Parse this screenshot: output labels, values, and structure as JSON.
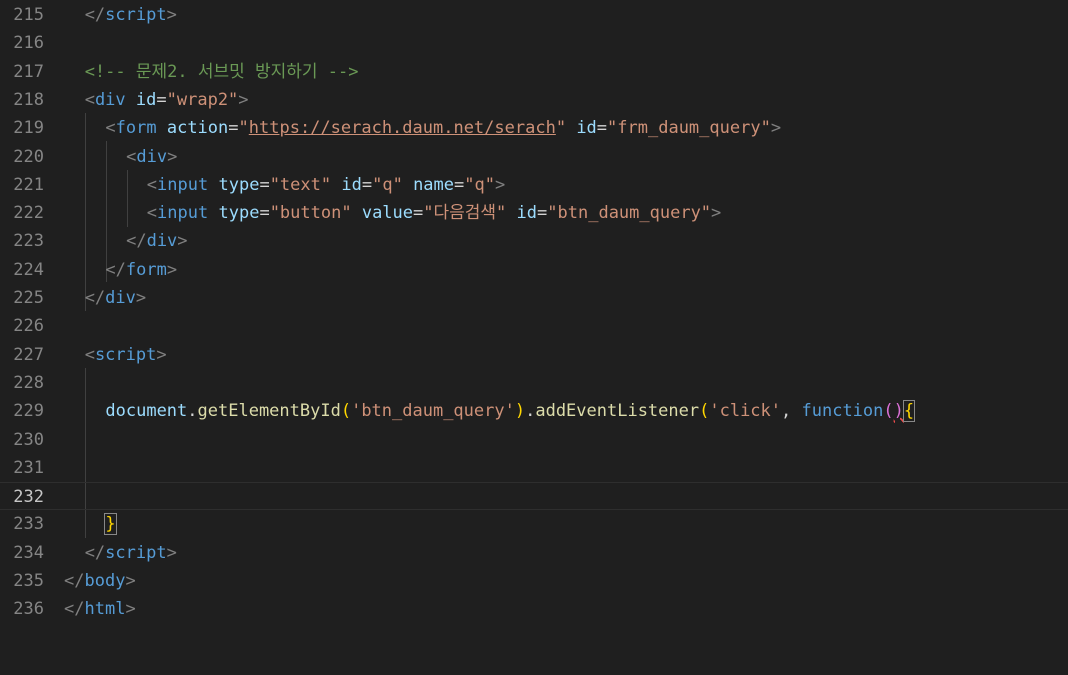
{
  "editor": {
    "lines": [
      {
        "no": "215",
        "indent": 1,
        "tokens": [
          [
            "t-punc",
            "</"
          ],
          [
            "t-tag",
            "script"
          ],
          [
            "t-punc",
            ">"
          ]
        ]
      },
      {
        "no": "216",
        "indent": 0,
        "tokens": []
      },
      {
        "no": "217",
        "indent": 1,
        "tokens": [
          [
            "t-com",
            "<!-- 문제2. 서브밋 방지하기 -->"
          ]
        ]
      },
      {
        "no": "218",
        "indent": 1,
        "tokens": [
          [
            "t-punc",
            "<"
          ],
          [
            "t-tag",
            "div"
          ],
          [
            "t-op",
            " "
          ],
          [
            "t-attr",
            "id"
          ],
          [
            "t-op",
            "="
          ],
          [
            "t-str",
            "\"wrap2\""
          ],
          [
            "t-punc",
            ">"
          ]
        ]
      },
      {
        "no": "219",
        "indent": 2,
        "tokens": [
          [
            "t-punc",
            "<"
          ],
          [
            "t-tag",
            "form"
          ],
          [
            "t-op",
            " "
          ],
          [
            "t-attr",
            "action"
          ],
          [
            "t-op",
            "="
          ],
          [
            "t-str",
            "\""
          ],
          [
            "t-link",
            "https://serach.daum.net/serach"
          ],
          [
            "t-str",
            "\""
          ],
          [
            "t-op",
            " "
          ],
          [
            "t-attr",
            "id"
          ],
          [
            "t-op",
            "="
          ],
          [
            "t-str",
            "\"frm_daum_query\""
          ],
          [
            "t-punc",
            ">"
          ]
        ]
      },
      {
        "no": "220",
        "indent": 3,
        "tokens": [
          [
            "t-punc",
            "<"
          ],
          [
            "t-tag",
            "div"
          ],
          [
            "t-punc",
            ">"
          ]
        ]
      },
      {
        "no": "221",
        "indent": 4,
        "tokens": [
          [
            "t-punc",
            "<"
          ],
          [
            "t-tag",
            "input"
          ],
          [
            "t-op",
            " "
          ],
          [
            "t-attr",
            "type"
          ],
          [
            "t-op",
            "="
          ],
          [
            "t-str",
            "\"text\""
          ],
          [
            "t-op",
            " "
          ],
          [
            "t-attr",
            "id"
          ],
          [
            "t-op",
            "="
          ],
          [
            "t-str",
            "\"q\""
          ],
          [
            "t-op",
            " "
          ],
          [
            "t-attr",
            "name"
          ],
          [
            "t-op",
            "="
          ],
          [
            "t-str",
            "\"q\""
          ],
          [
            "t-punc",
            ">"
          ]
        ]
      },
      {
        "no": "222",
        "indent": 4,
        "tokens": [
          [
            "t-punc",
            "<"
          ],
          [
            "t-tag",
            "input"
          ],
          [
            "t-op",
            " "
          ],
          [
            "t-attr",
            "type"
          ],
          [
            "t-op",
            "="
          ],
          [
            "t-str",
            "\"button\""
          ],
          [
            "t-op",
            " "
          ],
          [
            "t-attr",
            "value"
          ],
          [
            "t-op",
            "="
          ],
          [
            "t-str",
            "\"다음검색\""
          ],
          [
            "t-op",
            " "
          ],
          [
            "t-attr",
            "id"
          ],
          [
            "t-op",
            "="
          ],
          [
            "t-str",
            "\"btn_daum_query\""
          ],
          [
            "t-punc",
            ">"
          ]
        ]
      },
      {
        "no": "223",
        "indent": 3,
        "tokens": [
          [
            "t-punc",
            "</"
          ],
          [
            "t-tag",
            "div"
          ],
          [
            "t-punc",
            ">"
          ]
        ]
      },
      {
        "no": "224",
        "indent": 2,
        "tokens": [
          [
            "t-punc",
            "</"
          ],
          [
            "t-tag",
            "form"
          ],
          [
            "t-punc",
            ">"
          ]
        ]
      },
      {
        "no": "225",
        "indent": 1,
        "tokens": [
          [
            "t-punc",
            "</"
          ],
          [
            "t-tag",
            "div"
          ],
          [
            "t-punc",
            ">"
          ]
        ]
      },
      {
        "no": "226",
        "indent": 0,
        "tokens": []
      },
      {
        "no": "227",
        "indent": 1,
        "tokens": [
          [
            "t-punc",
            "<"
          ],
          [
            "t-tag",
            "script"
          ],
          [
            "t-punc",
            ">"
          ]
        ]
      },
      {
        "no": "228",
        "indent": 0,
        "tokens": []
      },
      {
        "no": "229",
        "indent": 2,
        "tokens": [
          [
            "t-var",
            "document"
          ],
          [
            "t-op",
            "."
          ],
          [
            "t-fn",
            "getElementById"
          ],
          [
            "t-brk1",
            "("
          ],
          [
            "t-str",
            "'btn_daum_query'"
          ],
          [
            "t-brk1",
            ")"
          ],
          [
            "t-op",
            "."
          ],
          [
            "t-fn",
            "addEventListener"
          ],
          [
            "t-brk1",
            "("
          ],
          [
            "t-str",
            "'click'"
          ],
          [
            "t-op",
            ", "
          ],
          [
            "t-kw",
            "function"
          ],
          [
            "t-brk2",
            "("
          ],
          [
            "t-brk2 t-squig",
            ")"
          ],
          [
            "t-brkm",
            "{"
          ]
        ]
      },
      {
        "no": "230",
        "indent": 0,
        "tokens": []
      },
      {
        "no": "231",
        "indent": 0,
        "tokens": []
      },
      {
        "no": "232",
        "indent": 0,
        "tokens": [],
        "current": true
      },
      {
        "no": "233",
        "indent": 2,
        "tokens": [
          [
            "t-brkm",
            "}"
          ]
        ]
      },
      {
        "no": "234",
        "indent": 1,
        "tokens": [
          [
            "t-punc",
            "</"
          ],
          [
            "t-tag",
            "script"
          ],
          [
            "t-punc",
            ">"
          ]
        ]
      },
      {
        "no": "235",
        "indent": 0,
        "tokens": [
          [
            "t-punc",
            "</"
          ],
          [
            "t-tag",
            "body"
          ],
          [
            "t-punc",
            ">"
          ]
        ]
      },
      {
        "no": "236",
        "indent": 0,
        "tokens": [
          [
            "t-punc",
            "</"
          ],
          [
            "t-tag",
            "html"
          ],
          [
            "t-punc",
            ">"
          ]
        ]
      }
    ],
    "colors": {
      "background": "#1f1f1f",
      "line_number": "#858585",
      "tag": "#569cd6",
      "attribute": "#9cdcfe",
      "string": "#ce9178",
      "comment": "#6a9955",
      "function": "#dcdcaa",
      "bracket": "#ffd700"
    }
  }
}
